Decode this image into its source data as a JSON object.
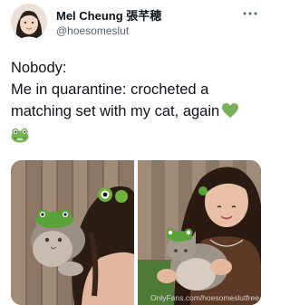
{
  "user": {
    "display_name": "Mel Cheung 張芊穂",
    "handle": "@hoesomeslut",
    "avatar_icon": "profile-photo"
  },
  "tweet": {
    "lines": [
      "Nobody:",
      "Me in quarantine: crocheted a",
      "matching set with my cat, again"
    ],
    "emojis": [
      "green-heart-emoji",
      "frog-emoji"
    ]
  },
  "media": {
    "watermark": "OnlyFans.com/hoesomeslutfree",
    "photos": [
      "cat-on-shoulder-photo",
      "holding-cat-photo"
    ]
  },
  "colors": {
    "text": "#0f1419",
    "secondary": "#536471",
    "heart": "#78b159",
    "frog": "#77b255"
  }
}
